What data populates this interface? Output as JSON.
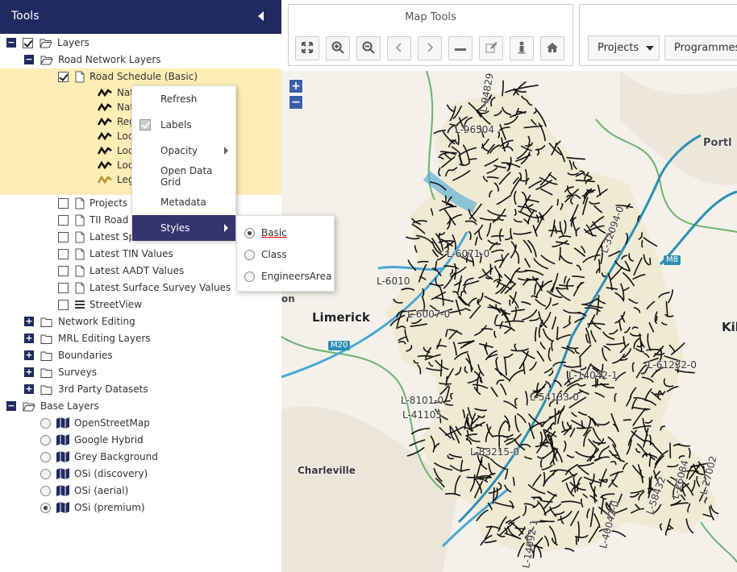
{
  "tools": {
    "title": "Tools"
  },
  "tree": {
    "layers": "Layers",
    "road_network_layers": "Road Network Layers",
    "road_schedule": "Road Schedule (Basic)",
    "sublegend": [
      {
        "label": "National Primary",
        "color": "#111111"
      },
      {
        "label": "National Secondary",
        "color": "#111111"
      },
      {
        "label": "Regional",
        "color": "#111111"
      },
      {
        "label": "Local Primary",
        "color": "#111111"
      },
      {
        "label": "Local Secondary",
        "color": "#111111"
      },
      {
        "label": "Local Tertiary",
        "color": "#111111"
      },
      {
        "label": "Legacy (Unclassified)",
        "color": "#b8952a"
      }
    ],
    "road_items": [
      "Projects",
      "TII Road",
      "Latest Sp",
      "Latest TIN Values",
      "Latest AADT Values",
      "Latest Surface Survey Values",
      "StreetView"
    ],
    "groups": [
      "Network Editing",
      "MRL Editing Layers",
      "Boundaries",
      "Surveys",
      "3rd Party Datasets"
    ],
    "base_layers": "Base Layers",
    "base_items": [
      "OpenStreetMap",
      "Google Hybrid",
      "Grey Background",
      "OSi (discovery)",
      "OSi (aerial)",
      "OSi (premium)"
    ]
  },
  "context_menu": {
    "refresh": "Refresh",
    "labels": "Labels",
    "opacity": "Opacity",
    "open_data_grid": "Open Data Grid",
    "metadata": "Metadata",
    "styles": "Styles"
  },
  "styles_menu": {
    "options": [
      "Basic",
      "Class",
      "EngineersArea"
    ],
    "selected": "Basic"
  },
  "maptools": {
    "title": "Map Tools"
  },
  "nav": {
    "projects": "Projects",
    "programmes": "Programmes"
  },
  "map": {
    "zoom_in": "+",
    "zoom_out": "−",
    "places": {
      "limerick": "Limerick",
      "charleville": "Charleville",
      "portlaoise_partial": "Portl",
      "kil_partial": "Kil",
      "on_partial": "on"
    },
    "motorways": [
      "M20",
      "M8"
    ],
    "road_labels": [
      "L-94829",
      "L-96504",
      "L-6007-0",
      "L-6010",
      "L-6071-0",
      "L-8101-0",
      "L-41105",
      "L-83215-0",
      "L-14042-1",
      "L-61232-0",
      "L-40042-0",
      "L-14092-1",
      "L-32094-0",
      "L-54133-0",
      "L-26084",
      "L-27002",
      "L-58432"
    ]
  },
  "colors": {
    "header": "#1f2a60",
    "selection": "#fdeeb5",
    "menu_active": "#35346e",
    "roads": "#111111",
    "river": "#4aa6d6",
    "motorway": "#2f8fb0",
    "county_fill": "#f1ead3"
  }
}
